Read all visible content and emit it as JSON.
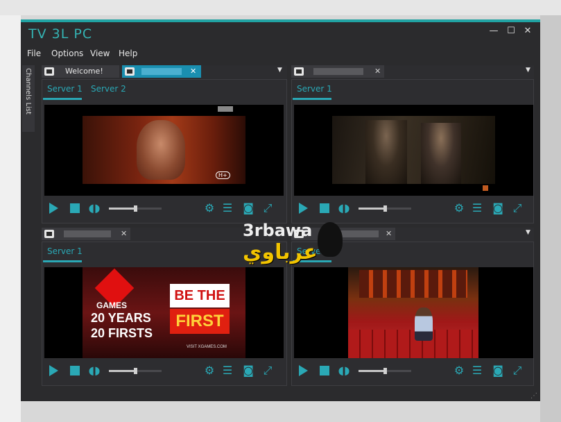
{
  "window": {
    "title": "TV 3L PC",
    "controls": {
      "minimize": "—",
      "maximize": "☐",
      "close": "✕"
    },
    "accent": "#21a3a3"
  },
  "menu": [
    "File",
    "Options",
    "View",
    "Help"
  ],
  "side_tab": "Channels List",
  "panes": {
    "top_left": {
      "tabs": [
        {
          "label": "Welcome!"
        },
        {
          "label": ""
        }
      ],
      "close_glyph": "✕",
      "dropdown_glyph": "▼",
      "server_tabs": [
        "Server 1",
        "Server 2"
      ]
    },
    "top_right": {
      "tabs": [
        {
          "label": ""
        }
      ],
      "close_glyph": "✕",
      "dropdown_glyph": "▼",
      "server_tabs": [
        "Server 1"
      ]
    },
    "bottom_left": {
      "tabs": [
        {
          "label": ""
        }
      ],
      "close_glyph": "✕",
      "server_tabs": [
        "Server 1"
      ],
      "video_text": {
        "be": "BE THE",
        "first": "FIRST",
        "games": "GAMES",
        "years": "20 YEARS",
        "firsts": "20 FIRSTS",
        "url": "VISIT XGAMES.COM"
      }
    },
    "bottom_right": {
      "tabs": [
        {
          "label": ""
        }
      ],
      "close_glyph": "✕",
      "dropdown_glyph": "▼",
      "server_tabs": [
        "Server 1"
      ]
    }
  },
  "channel_badge": "H+",
  "player_controls": {
    "icons": [
      "play-icon",
      "stop-icon",
      "volume-icon",
      "settings-icon",
      "database-icon",
      "camera-icon",
      "fullscreen-icon"
    ],
    "volume_level": 0.5
  },
  "watermark": {
    "latin": "3rbawa",
    "arabic": "عرباوي"
  }
}
